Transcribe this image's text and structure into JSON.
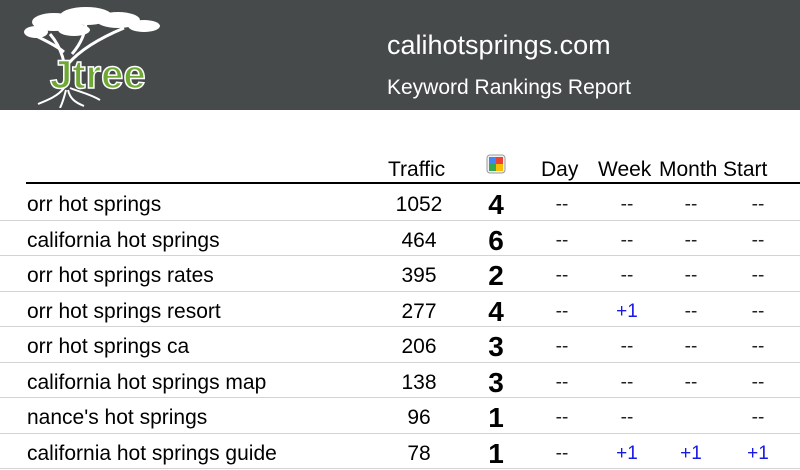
{
  "header": {
    "site": "calihotsprings.com",
    "report": "Keyword Rankings Report",
    "logo_text": "Jtree",
    "bg_color": "#464a4b"
  },
  "columns": {
    "traffic": "Traffic",
    "google_icon": "google-icon",
    "day": "Day",
    "week": "Week",
    "month": "Month",
    "start": "Start"
  },
  "rows": [
    {
      "keyword": "orr hot springs",
      "traffic": "1052",
      "rank": "4",
      "day": "--",
      "week": "--",
      "month": "--",
      "start": "--"
    },
    {
      "keyword": "california hot springs",
      "traffic": "464",
      "rank": "6",
      "day": "--",
      "week": "--",
      "month": "--",
      "start": "--"
    },
    {
      "keyword": "orr hot springs rates",
      "traffic": "395",
      "rank": "2",
      "day": "--",
      "week": "--",
      "month": "--",
      "start": "--"
    },
    {
      "keyword": "orr hot springs resort",
      "traffic": "277",
      "rank": "4",
      "day": "--",
      "week": "+1",
      "month": "--",
      "start": "--"
    },
    {
      "keyword": "orr hot springs ca",
      "traffic": "206",
      "rank": "3",
      "day": "--",
      "week": "--",
      "month": "--",
      "start": "--"
    },
    {
      "keyword": "california hot springs map",
      "traffic": "138",
      "rank": "3",
      "day": "--",
      "week": "--",
      "month": "--",
      "start": "--"
    },
    {
      "keyword": "nance's hot springs",
      "traffic": "96",
      "rank": "1",
      "day": "--",
      "week": "--",
      "month": "",
      "start": "--"
    },
    {
      "keyword": "california hot springs guide",
      "traffic": "78",
      "rank": "1",
      "day": "--",
      "week": "+1",
      "month": "+1",
      "start": "+1"
    }
  ]
}
